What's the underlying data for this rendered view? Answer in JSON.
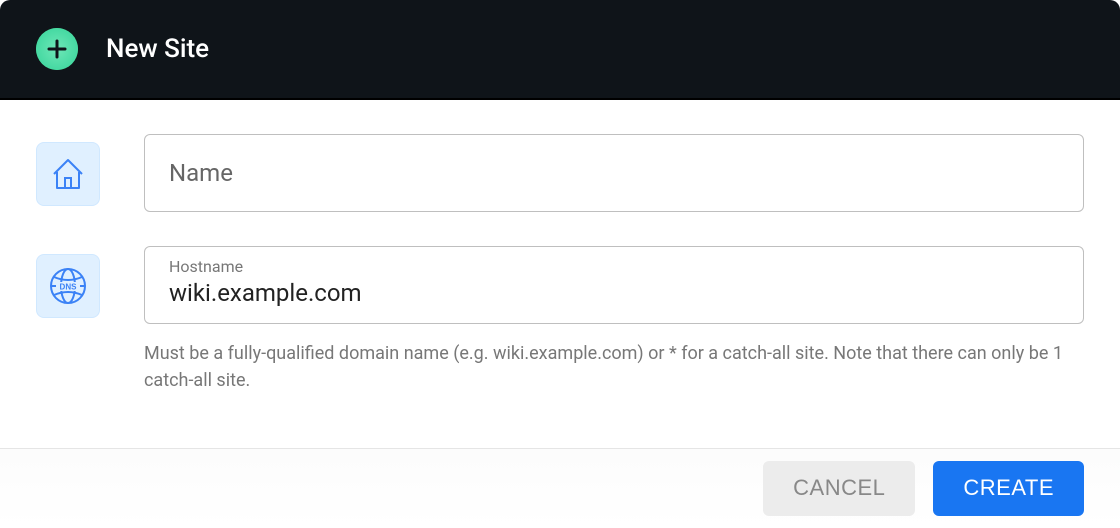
{
  "header": {
    "title": "New Site"
  },
  "form": {
    "name": {
      "placeholder": "Name",
      "value": ""
    },
    "hostname": {
      "label": "Hostname",
      "value": "wiki.example.com",
      "helper": "Must be a fully-qualified domain name (e.g. wiki.example.com) or * for a catch-all site. Note that there can only be 1 catch-all site."
    }
  },
  "footer": {
    "cancel_label": "CANCEL",
    "create_label": "CREATE"
  }
}
